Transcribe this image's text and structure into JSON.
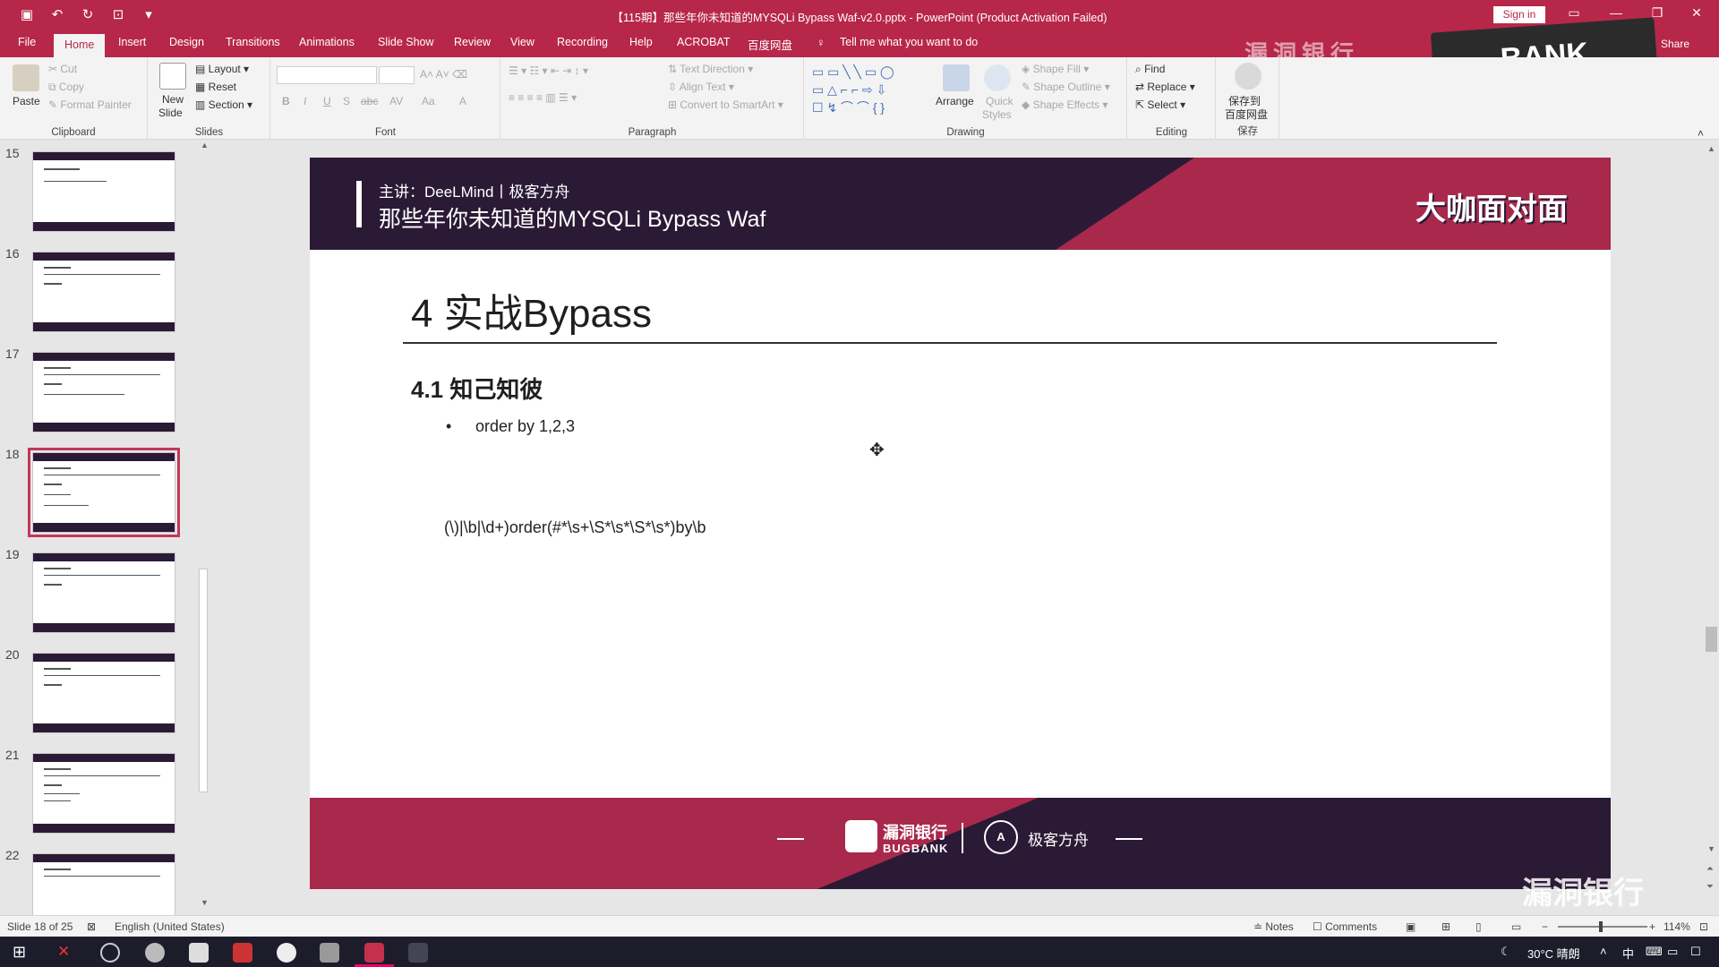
{
  "titlebar": {
    "title": "【115期】那些年你未知道的MYSQLi Bypass Waf-v2.0.pptx - PowerPoint (Product Activation Failed)",
    "sign_in": "Sign in"
  },
  "tabs": [
    "File",
    "Home",
    "Insert",
    "Design",
    "Transitions",
    "Animations",
    "Slide Show",
    "Review",
    "View",
    "Recording",
    "Help",
    "ACROBAT",
    "百度网盘"
  ],
  "tell_me": "Tell me what you want to do",
  "share": "Share",
  "watermark_text": "漏洞银行",
  "logo_text": "BANK",
  "ribbon": {
    "clipboard": {
      "paste": "Paste",
      "cut": "Cut",
      "copy": "Copy",
      "format_painter": "Format Painter",
      "group": "Clipboard"
    },
    "slides": {
      "new_slide_1": "New",
      "new_slide_2": "Slide",
      "layout": "Layout",
      "reset": "Reset",
      "section": "Section",
      "group": "Slides"
    },
    "font": {
      "group": "Font",
      "bold": "B",
      "italic": "I",
      "underline": "U",
      "strike": "S",
      "abc": "abc",
      "av": "AV",
      "aa": "Aa",
      "a": "A"
    },
    "paragraph": {
      "text_direction": "Text Direction",
      "align_text": "Align Text",
      "convert": "Convert to SmartArt",
      "group": "Paragraph"
    },
    "drawing": {
      "arrange": "Arrange",
      "quick_styles_1": "Quick",
      "quick_styles_2": "Styles",
      "shape_fill": "Shape Fill",
      "shape_outline": "Shape Outline",
      "shape_effects": "Shape Effects",
      "group": "Drawing"
    },
    "editing": {
      "find": "Find",
      "replace": "Replace",
      "select": "Select",
      "group": "Editing"
    },
    "save": {
      "label_1": "保存到",
      "label_2": "百度网盘",
      "group": "保存"
    }
  },
  "thumbnails": [
    {
      "num": "15"
    },
    {
      "num": "16"
    },
    {
      "num": "17"
    },
    {
      "num": "18"
    },
    {
      "num": "19"
    },
    {
      "num": "20"
    },
    {
      "num": "21"
    },
    {
      "num": "22"
    }
  ],
  "slide": {
    "speaker": "主讲：DeeLMind丨极客方舟",
    "title": "那些年你未知道的MYSQLi Bypass Waf",
    "badge": "大咖面对面",
    "heading": "4 实战Bypass",
    "subheading": "4.1 知己知彼",
    "bullet_marker": "•",
    "bullet": "order by 1,2,3",
    "regex": "(\\)|\\b|\\d+)order(#*\\s+\\S*\\s*\\S*\\s*)by\\b",
    "footer_logo1": "漏洞银行",
    "footer_logo1_sub": "BUGBANK",
    "footer_logo2": "极客方舟"
  },
  "status": {
    "slide_info": "Slide 18 of 25",
    "language": "English (United States)",
    "notes": "Notes",
    "comments": "Comments",
    "zoom": "114%"
  },
  "taskbar": {
    "weather": "30°C 晴朗",
    "ime": "中"
  }
}
